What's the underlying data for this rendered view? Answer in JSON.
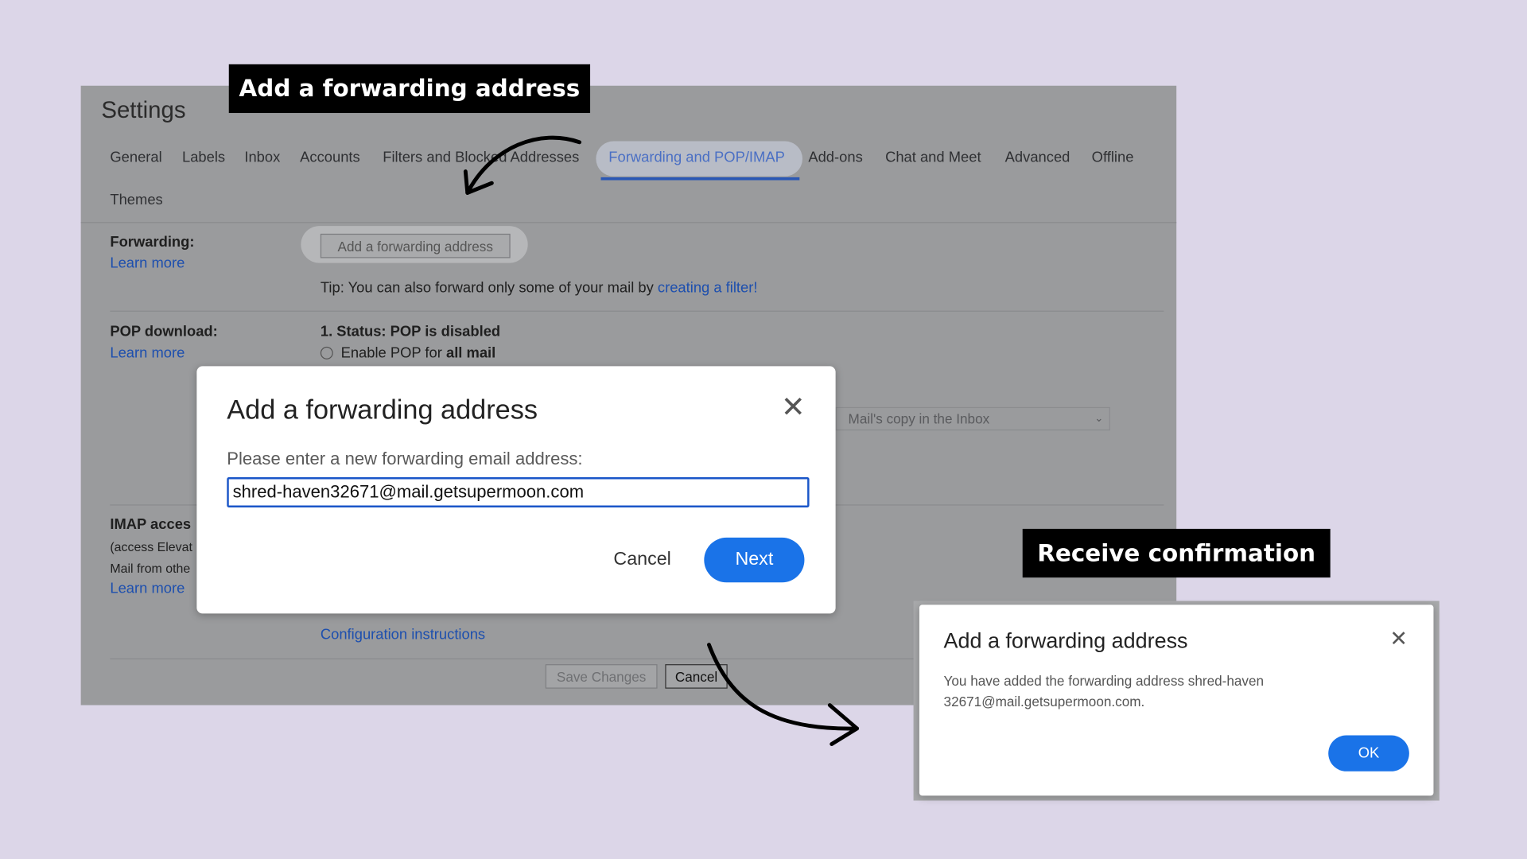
{
  "annotations": {
    "step1": "Add a forwarding address",
    "step2": "Receive confirmation"
  },
  "settings": {
    "title": "Settings",
    "tabs": [
      {
        "label": "General"
      },
      {
        "label": "Labels"
      },
      {
        "label": "Inbox"
      },
      {
        "label": "Accounts"
      },
      {
        "label": "Filters and Blocked Addresses"
      },
      {
        "label": "Forwarding and POP/IMAP",
        "active": true
      },
      {
        "label": "Add-ons"
      },
      {
        "label": "Chat and Meet"
      },
      {
        "label": "Advanced"
      },
      {
        "label": "Offline"
      },
      {
        "label": "Themes"
      }
    ],
    "forwarding": {
      "heading": "Forwarding:",
      "learn_more": "Learn more",
      "add_button": "Add a forwarding address",
      "tip_prefix": "Tip: You can also forward only some of your mail by ",
      "tip_link": "creating a filter!"
    },
    "pop": {
      "heading": "POP download:",
      "learn_more": "Learn more",
      "status": "1. Status: POP is disabled",
      "enable_prefix": "Enable POP for ",
      "enable_bold": "all mail",
      "select_value": "Mail's copy in the Inbox"
    },
    "imap": {
      "heading": "IMAP acces",
      "line1": "(access Elevat",
      "line2": "Mail from othe",
      "learn_more": "Learn more",
      "config_link": "Configuration instructions"
    },
    "footer": {
      "save": "Save Changes",
      "cancel": "Cancel"
    }
  },
  "dialog1": {
    "title": "Add a forwarding address",
    "prompt": "Please enter a new forwarding email address:",
    "email_value": "shred-haven32671@mail.getsupermoon.com",
    "cancel": "Cancel",
    "next": "Next"
  },
  "dialog2": {
    "title": "Add a forwarding address",
    "message": "You have added the forwarding address shred-haven32671@mail.getsupermoon.com.",
    "ok": "OK"
  },
  "colors": {
    "background": "#dcd6e8",
    "accent": "#1a73e8",
    "link": "#1d4fae"
  }
}
